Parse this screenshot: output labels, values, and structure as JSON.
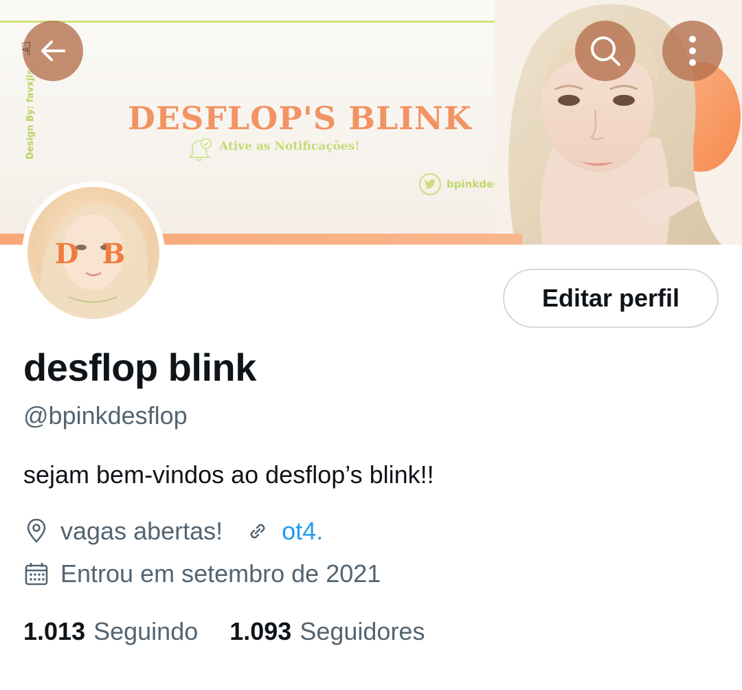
{
  "banner": {
    "credit": "Design By: favxjis",
    "title": "DESFLOP'S BLINK",
    "subtitle": "Ative as Notificações!",
    "handle": "bpinkdesflop"
  },
  "header": {
    "back_icon": "arrow-left-icon",
    "search_icon": "search-icon",
    "more_icon": "more-vertical-icon"
  },
  "avatar": {
    "text": "D B"
  },
  "profile": {
    "edit_label": "Editar perfil",
    "display_name": "desflop blink",
    "handle": "@bpinkdesflop",
    "bio": "sejam bem-vindos ao desflop’s blink!!",
    "location": "vagas abertas!",
    "link": "ot4.",
    "joined": "Entrou em setembro de 2021"
  },
  "stats": {
    "following_count": "1.013",
    "following_label": "Seguindo",
    "followers_count": "1.093",
    "followers_label": "Seguidores"
  },
  "colors": {
    "accent_orange": "#f29363",
    "accent_green": "#c6db78",
    "link_blue": "#1d9bf0",
    "secondary_text": "#536471"
  }
}
